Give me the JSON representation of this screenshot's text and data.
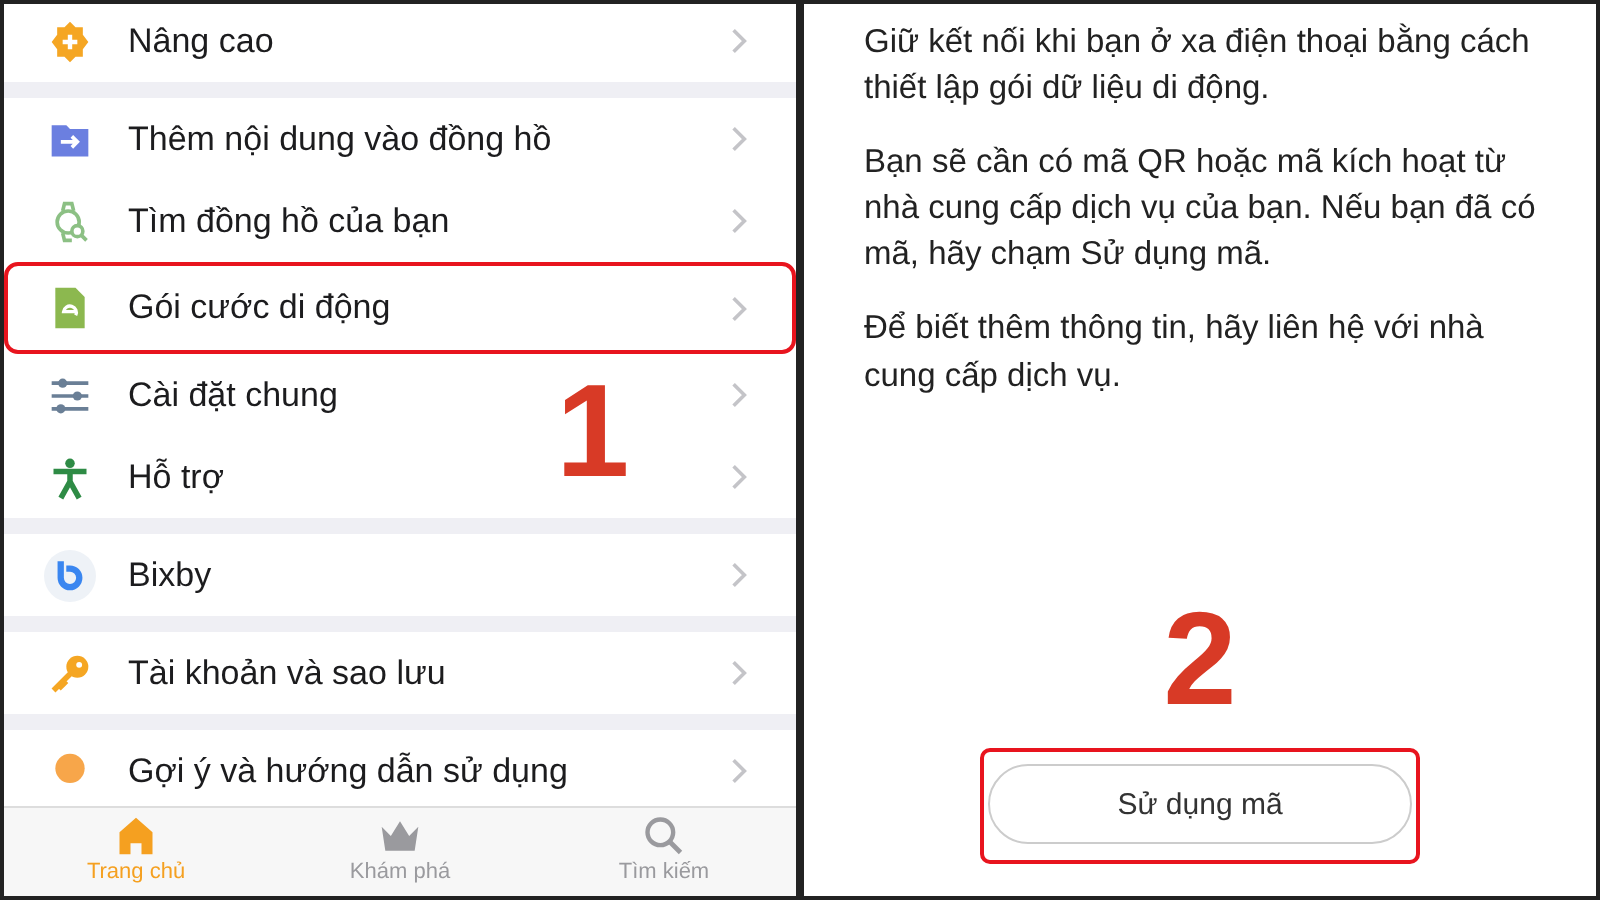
{
  "left_screen": {
    "groups": [
      {
        "items": [
          {
            "label": "Nâng cao",
            "highlighted": false
          }
        ]
      },
      {
        "items": [
          {
            "label": "Thêm nội dung vào đồng hồ",
            "highlighted": false
          },
          {
            "label": "Tìm đồng hồ của bạn",
            "highlighted": false
          },
          {
            "label": "Gói cước di động",
            "highlighted": true
          },
          {
            "label": "Cài đặt chung",
            "highlighted": false
          },
          {
            "label": "Hỗ trợ",
            "highlighted": false
          }
        ]
      },
      {
        "items": [
          {
            "label": "Bixby",
            "highlighted": false
          }
        ]
      },
      {
        "items": [
          {
            "label": "Tài khoản và sao lưu",
            "highlighted": false
          }
        ]
      },
      {
        "items": [
          {
            "label": "Gợi ý và hướng dẫn sử dụng",
            "highlighted": false
          }
        ]
      }
    ],
    "step_number": "1",
    "tab_bar": [
      {
        "label": "Trang chủ",
        "selected": true
      },
      {
        "label": "Khám phá",
        "selected": false
      },
      {
        "label": "Tìm kiếm",
        "selected": false
      }
    ]
  },
  "right_screen": {
    "paragraphs": [
      "Giữ kết nối khi bạn ở xa điện thoại bằng cách thiết lập gói dữ liệu di động.",
      "Bạn sẽ cần có mã QR hoặc mã kích hoạt từ nhà cung cấp dịch vụ của bạn. Nếu bạn đã có mã, hãy chạm Sử dụng mã.",
      "Để biết thêm thông tin, hãy liên hệ với nhà cung cấp dịch vụ."
    ],
    "step_number": "2",
    "button": {
      "label": "Sử dụng mã",
      "highlighted": true
    }
  }
}
